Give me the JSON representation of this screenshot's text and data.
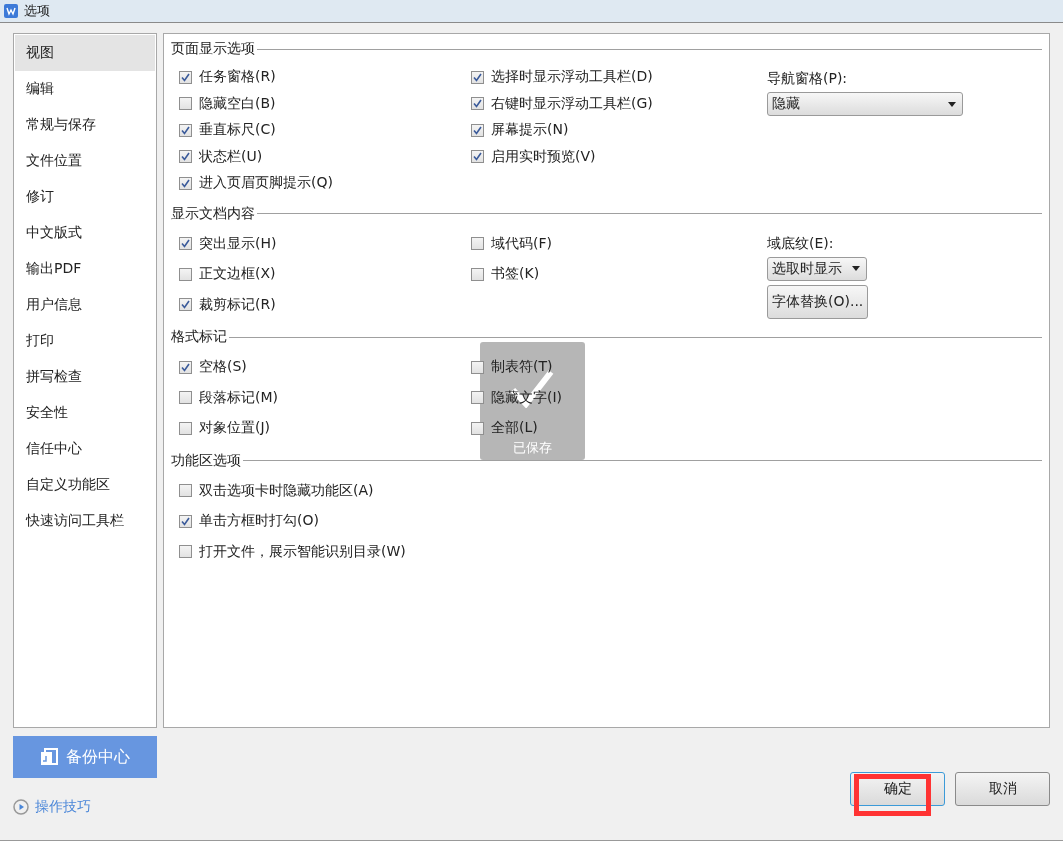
{
  "window": {
    "title": "选项"
  },
  "sidebar": {
    "items": [
      {
        "label": "视图",
        "selected": true
      },
      {
        "label": "编辑",
        "selected": false
      },
      {
        "label": "常规与保存",
        "selected": false
      },
      {
        "label": "文件位置",
        "selected": false
      },
      {
        "label": "修订",
        "selected": false
      },
      {
        "label": "中文版式",
        "selected": false
      },
      {
        "label": "输出PDF",
        "selected": false
      },
      {
        "label": "用户信息",
        "selected": false
      },
      {
        "label": "打印",
        "selected": false
      },
      {
        "label": "拼写检查",
        "selected": false
      },
      {
        "label": "安全性",
        "selected": false
      },
      {
        "label": "信任中心",
        "selected": false
      },
      {
        "label": "自定义功能区",
        "selected": false
      },
      {
        "label": "快速访问工具栏",
        "selected": false
      }
    ]
  },
  "sections": [
    {
      "title": "页面显示选项",
      "columns": [
        [
          {
            "label": "任务窗格(R)",
            "checked": true
          },
          {
            "label": "隐藏空白(B)",
            "checked": false
          },
          {
            "label": "垂直标尺(C)",
            "checked": true
          },
          {
            "label": "状态栏(U)",
            "checked": true
          },
          {
            "label": "进入页眉页脚提示(Q)",
            "checked": true
          }
        ],
        [
          {
            "label": "选择时显示浮动工具栏(D)",
            "checked": true
          },
          {
            "label": "右键时显示浮动工具栏(G)",
            "checked": true
          },
          {
            "label": "屏幕提示(N)",
            "checked": true
          },
          {
            "label": "启用实时预览(V)",
            "checked": true
          }
        ]
      ],
      "side": [
        {
          "kind": "label",
          "text": "导航窗格(P):"
        },
        {
          "kind": "dropdown",
          "value": "隐藏",
          "wide": true
        }
      ]
    },
    {
      "title": "显示文档内容",
      "columns": [
        [
          {
            "label": "突出显示(H)",
            "checked": true
          },
          {
            "label": "正文边框(X)",
            "checked": false
          },
          {
            "label": "裁剪标记(R)",
            "checked": true
          }
        ],
        [
          {
            "label": "域代码(F)",
            "checked": false
          },
          {
            "label": "书签(K)",
            "checked": false
          }
        ]
      ],
      "side": [
        {
          "kind": "label",
          "text": "域底纹(E):"
        },
        {
          "kind": "dropdown",
          "value": "选取时显示",
          "wide": false
        },
        {
          "kind": "button",
          "text": "字体替换(O)..."
        }
      ]
    },
    {
      "title": "格式标记",
      "toast": {
        "text": "已保存"
      },
      "columns": [
        [
          {
            "label": "空格(S)",
            "checked": true
          },
          {
            "label": "段落标记(M)",
            "checked": false
          },
          {
            "label": "对象位置(J)",
            "checked": false
          }
        ],
        [
          {
            "label": "制表符(T)",
            "checked": false
          },
          {
            "label": "隐藏文字(I)",
            "checked": false
          },
          {
            "label": "全部(L)",
            "checked": false
          }
        ]
      ]
    },
    {
      "title": "功能区选项",
      "columns": [
        [
          {
            "label": "双击选项卡时隐藏功能区(A)",
            "checked": false
          },
          {
            "label": "单击方框时打勾(O)",
            "checked": true
          },
          {
            "label": "打开文件，展示智能识别目录(W)",
            "checked": false
          }
        ]
      ]
    }
  ],
  "backup_button": {
    "label": "备份中心"
  },
  "tips_link": {
    "label": "操作技巧"
  },
  "buttons": [
    {
      "label": "确定",
      "highlighted": true,
      "default": true
    },
    {
      "label": "取消",
      "highlighted": false,
      "default": false
    }
  ]
}
